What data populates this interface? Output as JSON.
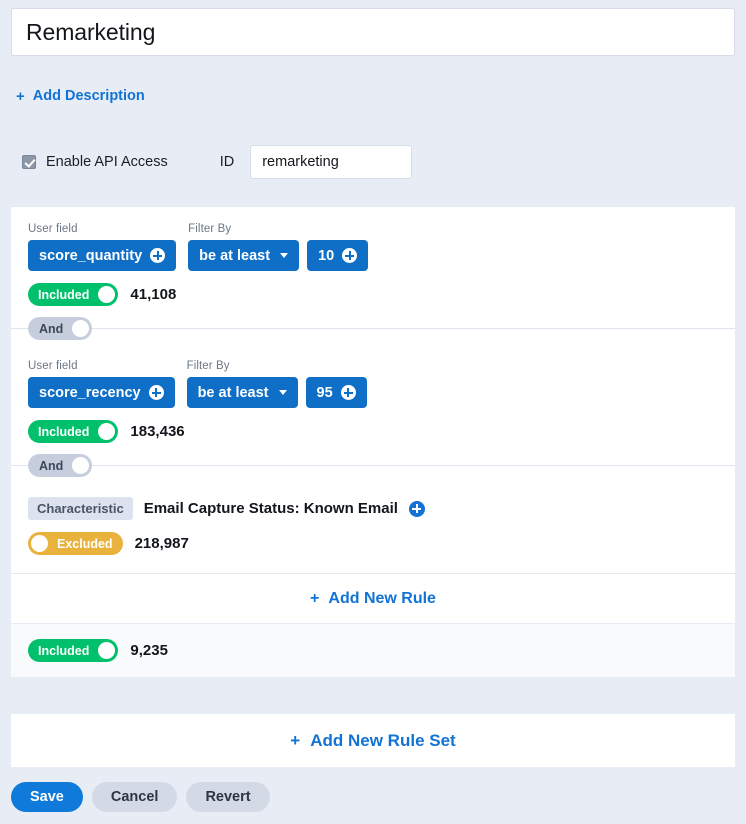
{
  "title": {
    "value": "Remarketing"
  },
  "add_description": {
    "icon": "plus-icon",
    "label": "Add Description"
  },
  "api": {
    "checkbox_label": "Enable API Access",
    "checked": true,
    "id_label": "ID",
    "id_value": "remarketing"
  },
  "labels": {
    "user_field": "User field",
    "filter_by": "Filter By"
  },
  "rules": [
    {
      "type": "user_field",
      "field_label": "User field",
      "field_value": "score_quantity",
      "field_icon": "plus-circle-icon",
      "filter_label": "Filter By",
      "filter_value": "be at least",
      "filter_icon": "chevron-down-icon",
      "threshold_value": "10",
      "threshold_icon": "plus-circle-icon",
      "status": "Included",
      "status_state": "included",
      "count": "41,108",
      "connector": "And"
    },
    {
      "type": "user_field",
      "field_label": "User field",
      "field_value": "score_recency",
      "field_icon": "plus-circle-icon",
      "filter_label": "Filter By",
      "filter_value": "be at least",
      "filter_icon": "chevron-down-icon",
      "threshold_value": "95",
      "threshold_icon": "plus-circle-icon",
      "status": "Included",
      "status_state": "included",
      "count": "183,436",
      "connector": "And"
    },
    {
      "type": "characteristic",
      "tag": "Characteristic",
      "text": "Email Capture Status: Known Email",
      "add_icon": "plus-circle-icon",
      "status": "Excluded",
      "status_state": "excluded",
      "count": "218,987"
    }
  ],
  "add_new_rule": {
    "icon": "plus-icon",
    "label": "Add New Rule"
  },
  "ruleset_summary": {
    "status": "Included",
    "count": "9,235"
  },
  "add_new_rule_set": {
    "icon": "plus-icon",
    "label": "Add New Rule Set"
  },
  "footer": {
    "save": "Save",
    "cancel": "Cancel",
    "revert": "Revert"
  },
  "colors": {
    "page_bg": "#e8edf5",
    "accent_blue": "#1273d4",
    "button_blue": "#0f6fc6",
    "included_green": "#00c06b",
    "excluded_amber": "#e8b23c",
    "connector_gray": "#c6cede"
  }
}
